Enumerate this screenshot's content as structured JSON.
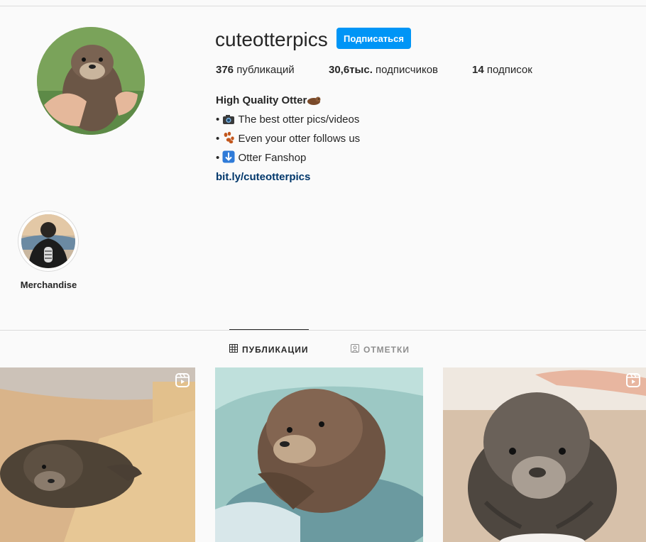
{
  "profile": {
    "username": "cuteotterpics",
    "follow_label": "Подписаться",
    "stats": {
      "posts_count": "376",
      "posts_label": "публикаций",
      "followers_count": "30,6тыс.",
      "followers_label": "подписчиков",
      "following_count": "14",
      "following_label": "подписок"
    },
    "bio": {
      "name": "High Quality Otter",
      "line1": "The best otter pics/videos",
      "line2": "Even your otter follows us",
      "line3": "Otter Fanshop",
      "link": "bit.ly/cuteotterpics",
      "bullet": "•"
    }
  },
  "highlights": [
    {
      "label": "Merchandise"
    }
  ],
  "tabs": {
    "posts": "ПУБЛИКАЦИИ",
    "tagged": "ОТМЕТКИ"
  },
  "colors": {
    "accent": "#0095f6",
    "link": "#00376b",
    "background": "#fafafa",
    "divider": "#dbdbdb"
  },
  "icons": [
    "grid-icon",
    "tag-icon",
    "reel-icon",
    "camera-icon",
    "paw-icon",
    "down-arrow-icon",
    "otter-emoji-icon"
  ]
}
